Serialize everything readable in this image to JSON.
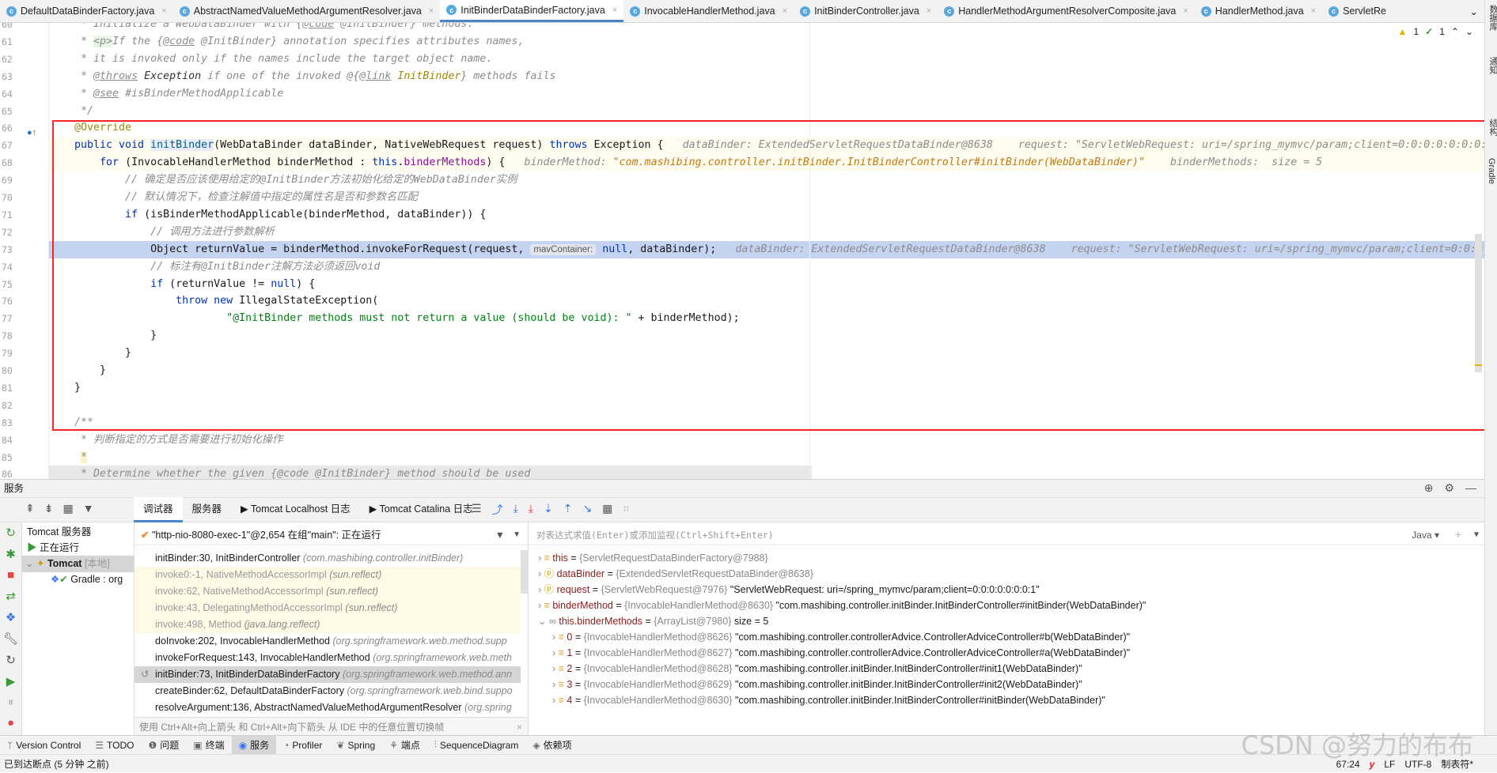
{
  "tabs": [
    {
      "label": "DefaultDataBinderFactory.java",
      "active": false
    },
    {
      "label": "AbstractNamedValueMethodArgumentResolver.java",
      "active": false
    },
    {
      "label": "InitBinderDataBinderFactory.java",
      "active": true
    },
    {
      "label": "InvocableHandlerMethod.java",
      "active": false
    },
    {
      "label": "InitBinderController.java",
      "active": false
    },
    {
      "label": "HandlerMethodArgumentResolverComposite.java",
      "active": false
    },
    {
      "label": "HandlerMethod.java",
      "active": false
    },
    {
      "label": "ServletRe",
      "active": false
    }
  ],
  "editor": {
    "warnings": "1",
    "checks": "1",
    "first_line": 60,
    "exec_line": 73,
    "lines": [
      [
        {
          "c": "cm",
          "t": " * Initialize a WebDataBinder with {"
        },
        {
          "c": "cm u",
          "t": "@code"
        },
        {
          "c": "cm",
          "t": " @InitBinder} methods."
        }
      ],
      [
        {
          "c": "cm",
          "t": " * "
        },
        {
          "c": "tag",
          "t": "<p>"
        },
        {
          "c": "cm",
          "t": "If the {"
        },
        {
          "c": "cm u",
          "t": "@code"
        },
        {
          "c": "cm",
          "t": " @InitBinder} annotation specifies attributes names,"
        }
      ],
      [
        {
          "c": "cm",
          "t": " * it is invoked only if the names include the target object name."
        }
      ],
      [
        {
          "c": "cm",
          "t": " * "
        },
        {
          "c": "cm u",
          "t": "@throws"
        },
        {
          "c": "cm",
          "t": " "
        },
        {
          "c": "cmd",
          "t": "Exception"
        },
        {
          "c": "cm",
          "t": " if one of the invoked @{"
        },
        {
          "c": "cm u",
          "t": "@link"
        },
        {
          "c": "cm",
          "t": " "
        },
        {
          "c": "cmo",
          "t": "InitBinder"
        },
        {
          "c": "cm",
          "t": "} methods fails"
        }
      ],
      [
        {
          "c": "cm",
          "t": " * "
        },
        {
          "c": "cm u",
          "t": "@see"
        },
        {
          "c": "cm",
          "t": " #isBinderMethodApplicable"
        }
      ],
      [
        {
          "c": "cm",
          "t": " */"
        }
      ],
      [
        {
          "c": "an",
          "t": "@Override"
        }
      ],
      [
        {
          "c": "kw",
          "t": "public void "
        },
        {
          "c": "fn",
          "t": "initBinder"
        },
        {
          "c": "",
          "t": "(WebDataBinder dataBinder, NativeWebRequest request) "
        },
        {
          "c": "kw",
          "t": "throws"
        },
        {
          "c": "",
          "t": " Exception {   "
        },
        {
          "c": "hint",
          "t": "dataBinder: ExtendedServletRequestDataBinder@8638    request: \"ServletWebRequest: uri=/spring_mymvc/param;client=0:0:0:0:0:0:0:1\""
        }
      ],
      [
        {
          "c": "",
          "t": "    "
        },
        {
          "c": "kw",
          "t": "for"
        },
        {
          "c": "",
          "t": " (InvocableHandlerMethod binderMethod : "
        },
        {
          "c": "kw",
          "t": "this"
        },
        {
          "c": "",
          "t": "."
        },
        {
          "c": "fld",
          "t": "binderMethods"
        },
        {
          "c": "",
          "t": ") {   "
        },
        {
          "c": "hint",
          "t": "binderMethod: "
        },
        {
          "c": "hintv",
          "t": "\"com.mashibing.controller.initBinder.InitBinderController#initBinder(WebDataBinder)\""
        },
        {
          "c": "hint",
          "t": "    binderMethods:  size = 5"
        }
      ],
      [
        {
          "c": "",
          "t": "        "
        },
        {
          "c": "cm",
          "t": "// 确定是否应该使用给定的@InitBinder方法初始化给定的WebDataBinder实例"
        }
      ],
      [
        {
          "c": "",
          "t": "        "
        },
        {
          "c": "cm",
          "t": "// 默认情况下，检查注解值中指定的属性名是否和参数名匹配"
        }
      ],
      [
        {
          "c": "",
          "t": "        "
        },
        {
          "c": "kw",
          "t": "if"
        },
        {
          "c": "",
          "t": " (isBinderMethodApplicable(binderMethod, dataBinder)) {"
        }
      ],
      [
        {
          "c": "",
          "t": "            "
        },
        {
          "c": "cm",
          "t": "// 调用方法进行参数解析"
        }
      ],
      [
        {
          "c": "",
          "t": "            Object returnValue = binderMethod.invokeForRequest(request, "
        },
        {
          "c": "chip",
          "t": "mavContainer:"
        },
        {
          "c": "kw",
          "t": " null"
        },
        {
          "c": "",
          "t": ", dataBinder);   "
        },
        {
          "c": "hint",
          "t": "dataBinder: ExtendedServletRequestDataBinder@8638    request: \"ServletWebRequest: uri=/spring_mymvc/param;client=0:0:0"
        }
      ],
      [
        {
          "c": "",
          "t": "            "
        },
        {
          "c": "cm",
          "t": "// 标注有@InitBinder注解方法必须返回void"
        }
      ],
      [
        {
          "c": "",
          "t": "            "
        },
        {
          "c": "kw",
          "t": "if"
        },
        {
          "c": "",
          "t": " (returnValue != "
        },
        {
          "c": "kw",
          "t": "null"
        },
        {
          "c": "",
          "t": ") {"
        }
      ],
      [
        {
          "c": "",
          "t": "                "
        },
        {
          "c": "kw",
          "t": "throw new"
        },
        {
          "c": "",
          "t": " IllegalStateException("
        }
      ],
      [
        {
          "c": "",
          "t": "                        "
        },
        {
          "c": "str",
          "t": "\"@InitBinder methods must not return a value (should be void): \""
        },
        {
          "c": "",
          "t": " + binderMethod);"
        }
      ],
      [
        {
          "c": "",
          "t": "            }"
        }
      ],
      [
        {
          "c": "",
          "t": "        }"
        }
      ],
      [
        {
          "c": "",
          "t": "    }"
        }
      ],
      [
        {
          "c": "",
          "t": "}"
        }
      ],
      [
        {
          "c": "",
          "t": ""
        }
      ],
      [
        {
          "c": "cm",
          "t": "/**"
        }
      ],
      [
        {
          "c": "cm",
          "t": " * 判断指定的方式是否需要进行初始化操作"
        }
      ],
      [
        {
          "c": "cm",
          "t": " "
        },
        {
          "c": "cm star",
          "t": "*"
        }
      ],
      [
        {
          "c": "cm",
          "t": " * Determine whether the given {@code @InitBinder} method should be used"
        }
      ]
    ]
  },
  "right_stripe": [
    "数据库",
    "通知",
    "结构",
    "Gradle"
  ],
  "services": {
    "title": "服务",
    "tabs": [
      "调试器",
      "服务器",
      "Tomcat Localhost 日志",
      "Tomcat Catalina 日志"
    ],
    "tree": {
      "server": "Tomcat 服务器",
      "running": "正在运行",
      "tomcat": "Tomcat",
      "tomcat_tag": "[本地]",
      "gradle": "Gradle : org"
    },
    "thread": "\"http-nio-8080-exec-1\"@2,654 在组\"main\": 正在运行",
    "frames": [
      {
        "m": "initBinder:30, InitBinderController",
        "p": "(com.mashibing.controller.initBinder)",
        "lib": false,
        "sel": false
      },
      {
        "m": "invoke0:-1, NativeMethodAccessorImpl",
        "p": "(sun.reflect)",
        "lib": true,
        "sel": false
      },
      {
        "m": "invoke:62, NativeMethodAccessorImpl",
        "p": "(sun.reflect)",
        "lib": true,
        "sel": false
      },
      {
        "m": "invoke:43, DelegatingMethodAccessorImpl",
        "p": "(sun.reflect)",
        "lib": true,
        "sel": false
      },
      {
        "m": "invoke:498, Method",
        "p": "(java.lang.reflect)",
        "lib": true,
        "sel": false
      },
      {
        "m": "doInvoke:202, InvocableHandlerMethod",
        "p": "(org.springframework.web.method.supp",
        "lib": false,
        "sel": false
      },
      {
        "m": "invokeForRequest:143, InvocableHandlerMethod",
        "p": "(org.springframework.web.meth",
        "lib": false,
        "sel": false
      },
      {
        "m": "initBinder:73, InitBinderDataBinderFactory",
        "p": "(org.springframework.web.method.ann",
        "lib": false,
        "sel": true
      },
      {
        "m": "createBinder:62, DefaultDataBinderFactory",
        "p": "(org.springframework.web.bind.suppo",
        "lib": false,
        "sel": false
      },
      {
        "m": "resolveArgument:136, AbstractNamedValueMethodArgumentResolver",
        "p": "(org.spring",
        "lib": false,
        "sel": false
      }
    ],
    "frames_hint": "使用 Ctrl+Alt+向上箭头 和 Ctrl+Alt+向下箭头 从 IDE 中的任意位置切换帧",
    "eval_placeholder": "对表达式求值(Enter)或添加监视(Ctrl+Shift+Enter)",
    "lang": "Java ▾",
    "vars": [
      {
        "n": "this",
        "icon": "field",
        "t": "{ServletRequestDataBinderFactory@7988}",
        "v": "",
        "lvl": 0,
        "open": false
      },
      {
        "n": "dataBinder",
        "icon": "param",
        "t": "{ExtendedServletRequestDataBinder@8638}",
        "v": "",
        "lvl": 0,
        "open": false
      },
      {
        "n": "request",
        "icon": "param",
        "t": "{ServletWebRequest@7976}",
        "v": "\"ServletWebRequest: uri=/spring_mymvc/param;client=0:0:0:0:0:0:0:1\"",
        "lvl": 0,
        "open": false
      },
      {
        "n": "binderMethod",
        "icon": "field",
        "t": "{InvocableHandlerMethod@8630}",
        "v": "\"com.mashibing.controller.initBinder.InitBinderController#initBinder(WebDataBinder)\"",
        "lvl": 0,
        "open": false
      },
      {
        "n": "this.binderMethods",
        "icon": "watch",
        "t": "{ArrayList@7980}",
        "v": " size = 5",
        "lvl": 0,
        "open": true
      },
      {
        "n": "0",
        "icon": "field",
        "t": "{InvocableHandlerMethod@8626}",
        "v": "\"com.mashibing.controller.controllerAdvice.ControllerAdviceController#b(WebDataBinder)\"",
        "lvl": 1,
        "open": false
      },
      {
        "n": "1",
        "icon": "field",
        "t": "{InvocableHandlerMethod@8627}",
        "v": "\"com.mashibing.controller.controllerAdvice.ControllerAdviceController#a(WebDataBinder)\"",
        "lvl": 1,
        "open": false
      },
      {
        "n": "2",
        "icon": "field",
        "t": "{InvocableHandlerMethod@8628}",
        "v": "\"com.mashibing.controller.initBinder.InitBinderController#init1(WebDataBinder)\"",
        "lvl": 1,
        "open": false
      },
      {
        "n": "3",
        "icon": "field",
        "t": "{InvocableHandlerMethod@8629}",
        "v": "\"com.mashibing.controller.initBinder.InitBinderController#init2(WebDataBinder)\"",
        "lvl": 1,
        "open": false
      },
      {
        "n": "4",
        "icon": "field",
        "t": "{InvocableHandlerMethod@8630}",
        "v": "\"com.mashibing.controller.initBinder.InitBinderController#initBinder(WebDataBinder)\"",
        "lvl": 1,
        "open": false
      }
    ]
  },
  "bottom_tools": [
    {
      "label": "Version Control",
      "icon": "version-control-icon",
      "g": "ᛘ",
      "active": false
    },
    {
      "label": "TODO",
      "icon": "todo-icon",
      "g": "☰",
      "active": false
    },
    {
      "label": "问题",
      "icon": "problems-icon",
      "g": "❶",
      "active": false
    },
    {
      "label": "终端",
      "icon": "terminal-icon",
      "g": "▣",
      "active": false
    },
    {
      "label": "服务",
      "icon": "services-icon",
      "g": "◉",
      "active": true
    },
    {
      "label": "Profiler",
      "icon": "profiler-icon",
      "g": "◔",
      "active": false
    },
    {
      "label": "Spring",
      "icon": "spring-icon",
      "g": "❦",
      "active": false
    },
    {
      "label": "端点",
      "icon": "endpoints-icon",
      "g": "⚘",
      "active": false
    },
    {
      "label": "SequenceDiagram",
      "icon": "sequence-diagram-icon",
      "g": "⫶",
      "active": false
    },
    {
      "label": "依赖项",
      "icon": "dependencies-icon",
      "g": "◈",
      "active": false
    }
  ],
  "status": {
    "message": "已到达断点 (5 分钟 之前)",
    "position": "67:24",
    "line_sep": "LF",
    "encoding": "UTF-8",
    "indent": "制表符*"
  },
  "watermark": "CSDN @努力的布布",
  "colors": {
    "keyword": "#0033b3",
    "string": "#067d17",
    "comment": "#8c8c8c",
    "annotation": "#9e880d",
    "exec_line": "#c4d3f0",
    "highlight_box": "#ff2424"
  }
}
